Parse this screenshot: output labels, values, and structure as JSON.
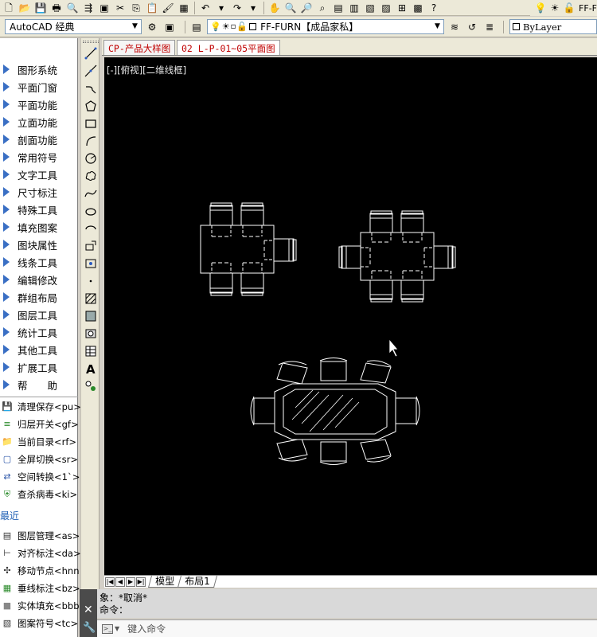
{
  "toolbar_top": {
    "right_text": "FF-F"
  },
  "workspace": {
    "selected": "AutoCAD 经典"
  },
  "layer": {
    "selected": "FF-FURN【成品家私】"
  },
  "color": {
    "selected": "ByLayer"
  },
  "palette": {
    "menu_items": [
      {
        "label": "图形系统"
      },
      {
        "label": "平面门窗"
      },
      {
        "label": "平面功能"
      },
      {
        "label": "立面功能"
      },
      {
        "label": "剖面功能"
      },
      {
        "label": "常用符号"
      },
      {
        "label": "文字工具"
      },
      {
        "label": "尺寸标注"
      },
      {
        "label": "特殊工具"
      },
      {
        "label": "填充图案"
      },
      {
        "label": "图块属性"
      },
      {
        "label": "线条工具"
      },
      {
        "label": "编辑修改"
      },
      {
        "label": "群组布局"
      },
      {
        "label": "图层工具"
      },
      {
        "label": "统计工具"
      },
      {
        "label": "其他工具"
      },
      {
        "label": "扩展工具"
      },
      {
        "label": "帮　　助"
      }
    ],
    "commands": [
      {
        "label": "清理保存<pu>",
        "icon": "save-icon"
      },
      {
        "label": "归层开关<gf>",
        "icon": "layers-icon"
      },
      {
        "label": "当前目录<rf>",
        "icon": "dwg-folder-icon"
      },
      {
        "label": "全屏切换<sr>",
        "icon": "fullscreen-icon"
      },
      {
        "label": "空间转换<1`>",
        "icon": "space-convert-icon"
      },
      {
        "label": "查杀病毒<ki>",
        "icon": "shield-icon"
      }
    ],
    "recent_label": "最近",
    "recent_commands": [
      {
        "label": "图层管理<as>",
        "icon": "layer-manage-icon"
      },
      {
        "label": "对齐标注<da>",
        "icon": "align-dim-icon"
      },
      {
        "label": "移动节点<hnn",
        "icon": "move-node-icon"
      },
      {
        "label": "垂线标注<bz>",
        "icon": "perp-dim-icon"
      },
      {
        "label": "实体填充<bbb",
        "icon": "solid-fill-icon"
      },
      {
        "label": "图案符号<tc>",
        "icon": "pattern-symbol-icon"
      }
    ]
  },
  "doc_tabs": [
    {
      "label": "CP-产品大样图",
      "active": false
    },
    {
      "label": "02 L-P-01~05平面图",
      "active": true
    }
  ],
  "viewport": {
    "label": "[-][俯视][二维线框]"
  },
  "layout_tabs": [
    {
      "label": "模型",
      "active": true
    },
    {
      "label": "布局1",
      "active": false
    }
  ],
  "command_line": {
    "history": [
      "象：*取消*",
      "命令："
    ],
    "placeholder": "键入命令"
  },
  "colors": {
    "canvas_bg": "#000000",
    "drawing_lines": "#ffffff",
    "tab_text": "#c00000",
    "palette_arrow": "#3a6fc4"
  }
}
